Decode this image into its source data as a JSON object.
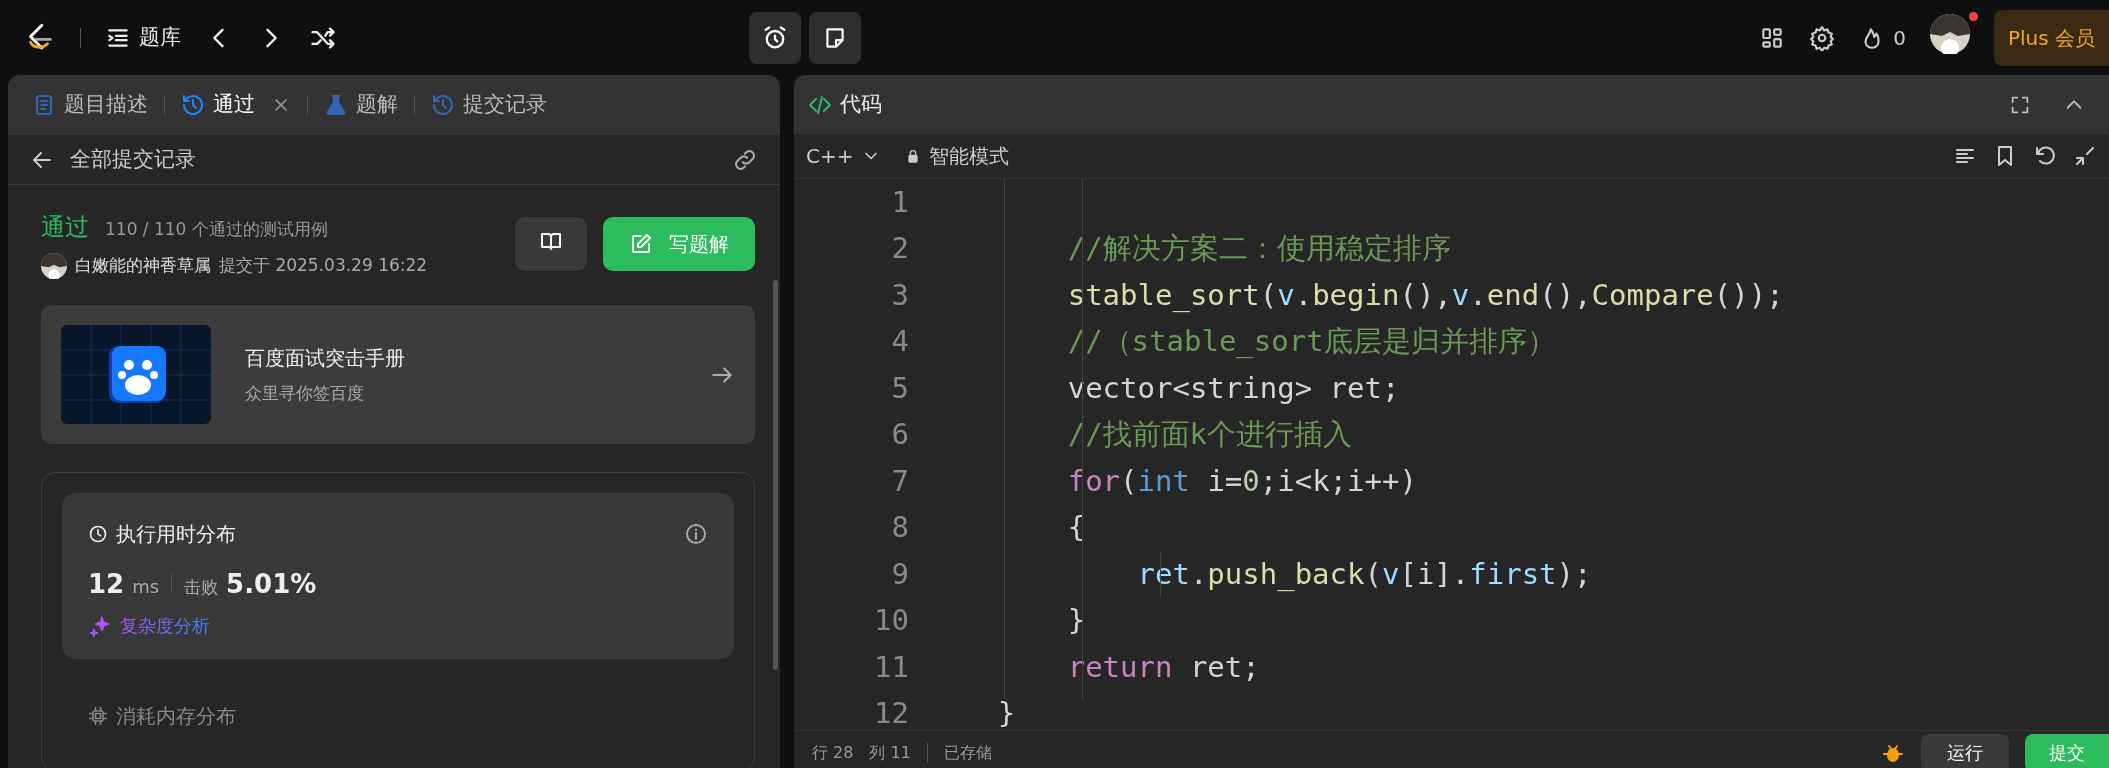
{
  "topbar": {
    "nav_label": "题库",
    "streak": "0",
    "plus": "Plus 会员",
    "notification": true
  },
  "left_panel": {
    "tabs": [
      {
        "label": "题目描述",
        "selected": false,
        "closable": false
      },
      {
        "label": "通过",
        "selected": true,
        "closable": true
      },
      {
        "label": "题解",
        "selected": false,
        "closable": false
      },
      {
        "label": "提交记录",
        "selected": false,
        "closable": false
      }
    ],
    "back_label": "全部提交记录",
    "submission": {
      "status": "通过",
      "tests": "110 / 110 个通过的测试用例",
      "user": "白嫩能的神香草属",
      "submitted": "提交于 2025.03.29 16:22",
      "write_button": "写题解"
    },
    "promo": {
      "title": "百度面试突击手册",
      "subtitle": "众里寻你签百度"
    },
    "runtime": {
      "title": "执行用时分布",
      "value": "12",
      "unit": "ms",
      "beat_label": "击败",
      "beat": "5.01%",
      "analysis": "复杂度分析"
    },
    "memory": {
      "title": "消耗内存分布"
    }
  },
  "editor": {
    "title": "代码",
    "language": "C++",
    "mode": "智能模式",
    "lines": [
      {
        "number": "1",
        "kind": "blank"
      },
      {
        "number": "2",
        "kind": "block",
        "tokens": [
          {
            "text": "//解决方案二：使用稳定排序",
            "kind": "comment"
          }
        ]
      },
      {
        "number": "3",
        "kind": "block",
        "tokens": [
          {
            "text": "stable_sort",
            "kind": "func"
          },
          {
            "text": "(",
            "kind": "plain"
          },
          {
            "text": "v",
            "kind": "var"
          },
          {
            "text": ".",
            "kind": "plain"
          },
          {
            "text": "begin",
            "kind": "func"
          },
          {
            "text": "(),",
            "kind": "plain"
          },
          {
            "text": "v",
            "kind": "var"
          },
          {
            "text": ".",
            "kind": "plain"
          },
          {
            "text": "end",
            "kind": "func"
          },
          {
            "text": "(),",
            "kind": "plain"
          },
          {
            "text": "Compare",
            "kind": "func"
          },
          {
            "text": "());",
            "kind": "plain"
          }
        ]
      },
      {
        "number": "4",
        "kind": "block",
        "tokens": [
          {
            "text": "//（stable_sort底层是归并排序）",
            "kind": "comment"
          }
        ]
      },
      {
        "number": "5",
        "kind": "block",
        "tokens": [
          {
            "text": "vector<string> ret;",
            "kind": "plain"
          }
        ]
      },
      {
        "number": "6",
        "kind": "block",
        "tokens": [
          {
            "text": "//找前面k个进行插入",
            "kind": "comment"
          }
        ]
      },
      {
        "number": "7",
        "kind": "block",
        "tokens": [
          {
            "text": "for",
            "kind": "keyword"
          },
          {
            "text": "(",
            "kind": "plain"
          },
          {
            "text": "int",
            "kind": "type"
          },
          {
            "text": " i=",
            "kind": "plain"
          },
          {
            "text": "0",
            "kind": "number"
          },
          {
            "text": ";i<k;i++)",
            "kind": "plain"
          }
        ]
      },
      {
        "number": "8",
        "kind": "block",
        "tokens": [
          {
            "text": "{",
            "kind": "plain"
          }
        ]
      },
      {
        "number": "9",
        "kind": "nested",
        "tokens": [
          {
            "text": "ret",
            "kind": "var"
          },
          {
            "text": ".",
            "kind": "plain"
          },
          {
            "text": "push_back",
            "kind": "func"
          },
          {
            "text": "(",
            "kind": "plain"
          },
          {
            "text": "v",
            "kind": "var"
          },
          {
            "text": "[i].",
            "kind": "plain"
          },
          {
            "text": "first",
            "kind": "var"
          },
          {
            "text": ");",
            "kind": "plain"
          }
        ]
      },
      {
        "number": "10",
        "kind": "block",
        "tokens": [
          {
            "text": "}",
            "kind": "plain"
          }
        ]
      },
      {
        "number": "11",
        "kind": "block",
        "tokens": [
          {
            "text": "return",
            "kind": "keyword"
          },
          {
            "text": " ret;",
            "kind": "plain"
          }
        ]
      },
      {
        "number": "12",
        "kind": "top",
        "tokens": [
          {
            "text": "}",
            "kind": "plain"
          }
        ]
      }
    ],
    "status": {
      "row": "行 28",
      "col": "列 11",
      "saved": "已存储"
    },
    "run_button": "运行",
    "submit_button": "提交"
  }
}
